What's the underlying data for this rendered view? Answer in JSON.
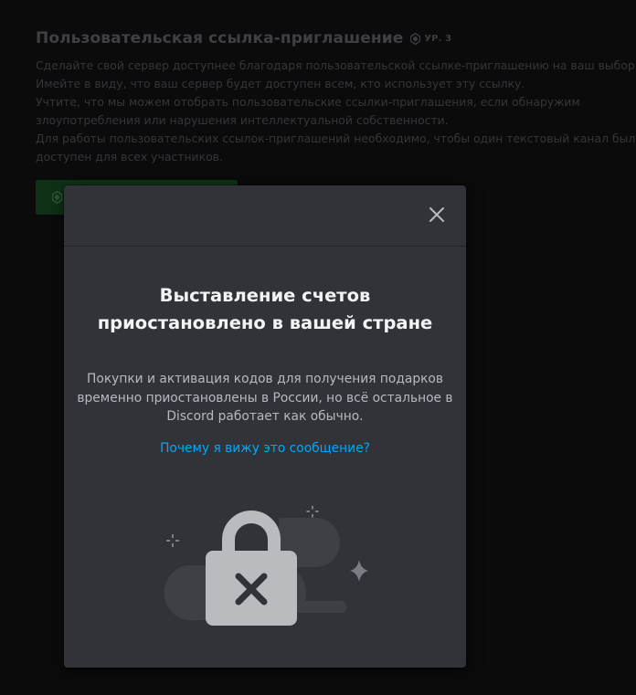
{
  "background": {
    "section_title": "Пользовательская ссылка-приглашение",
    "badge_label": "УР. 3",
    "description_lines": [
      "Сделайте свой сервер доступнее благодаря пользовательской ссылке-приглашению на ваш выбор.",
      "Имейте в виду, что ваш сервер будет доступен всем, кто использует эту ссылку.",
      "Учтите, что мы можем отобрать пользовательские ссылки-приглашения, если обнаружим",
      "злоупотребления или нарушения интеллектуальной собственности.",
      "Для работы пользовательских ссылок-приглашений необходимо, чтобы один текстовый канал был",
      "доступен для всех участников."
    ]
  },
  "modal": {
    "title_lines": [
      "Выставление счетов",
      "приостановлено в вашей стране"
    ],
    "body_lines": [
      "Покупки и активация кодов для получения подарков",
      "временно приостановлены в России, но всё остальное в",
      "Discord работает как обычно."
    ],
    "link_text": "Почему я вижу это сообщение?"
  },
  "icons": {
    "close": "close-icon",
    "lock": "locked-padlock-icon",
    "boost": "boost-gem-icon"
  },
  "colors": {
    "modal_bg": "#313338",
    "link": "#00a8fc",
    "title": "#f2f3f5",
    "body": "#b5bac1",
    "page_bg": "#0b0b0c"
  }
}
